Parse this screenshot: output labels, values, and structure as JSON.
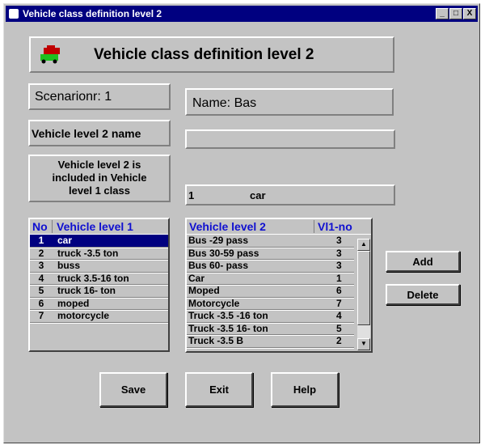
{
  "window": {
    "title": "Vehicle class definition level 2",
    "controls": [
      "_",
      "□",
      "X"
    ]
  },
  "header": {
    "title": "Vehicle class definition level 2",
    "icon": "cars-icon"
  },
  "scenario": "Scenarionr: 1",
  "name": "Name: Bas",
  "level2_name_label": "Vehicle level 2 name",
  "level2_name_value": "",
  "included_label": "Vehicle level 2 is included in Vehicle level 1 class",
  "selected_class": {
    "no": "1",
    "name": "car"
  },
  "list1": {
    "headers": [
      "No",
      "Vehicle level 1"
    ],
    "selected_index": 0,
    "rows": [
      {
        "no": "1",
        "name": "car"
      },
      {
        "no": "2",
        "name": "truck -3.5 ton"
      },
      {
        "no": "3",
        "name": "buss"
      },
      {
        "no": "4",
        "name": "truck 3.5-16 ton"
      },
      {
        "no": "5",
        "name": "truck 16- ton"
      },
      {
        "no": "6",
        "name": "moped"
      },
      {
        "no": "7",
        "name": "motorcycle"
      }
    ]
  },
  "list2": {
    "headers": [
      "Vehicle level 2",
      "Vl1-no"
    ],
    "rows": [
      {
        "name": "Bus -29 pass",
        "no": "3"
      },
      {
        "name": "Bus 30-59 pass",
        "no": "3"
      },
      {
        "name": "Bus 60- pass",
        "no": "3"
      },
      {
        "name": "Car",
        "no": "1"
      },
      {
        "name": "Moped",
        "no": "6"
      },
      {
        "name": "Motorcycle",
        "no": "7"
      },
      {
        "name": "Truck -3.5  -16 ton",
        "no": "4"
      },
      {
        "name": "Truck -3.5  16- ton",
        "no": "5"
      },
      {
        "name": "Truck -3.5  B",
        "no": "2"
      }
    ]
  },
  "buttons": {
    "add": "Add",
    "delete": "Delete",
    "save": "Save",
    "exit": "Exit",
    "help": "Help"
  }
}
